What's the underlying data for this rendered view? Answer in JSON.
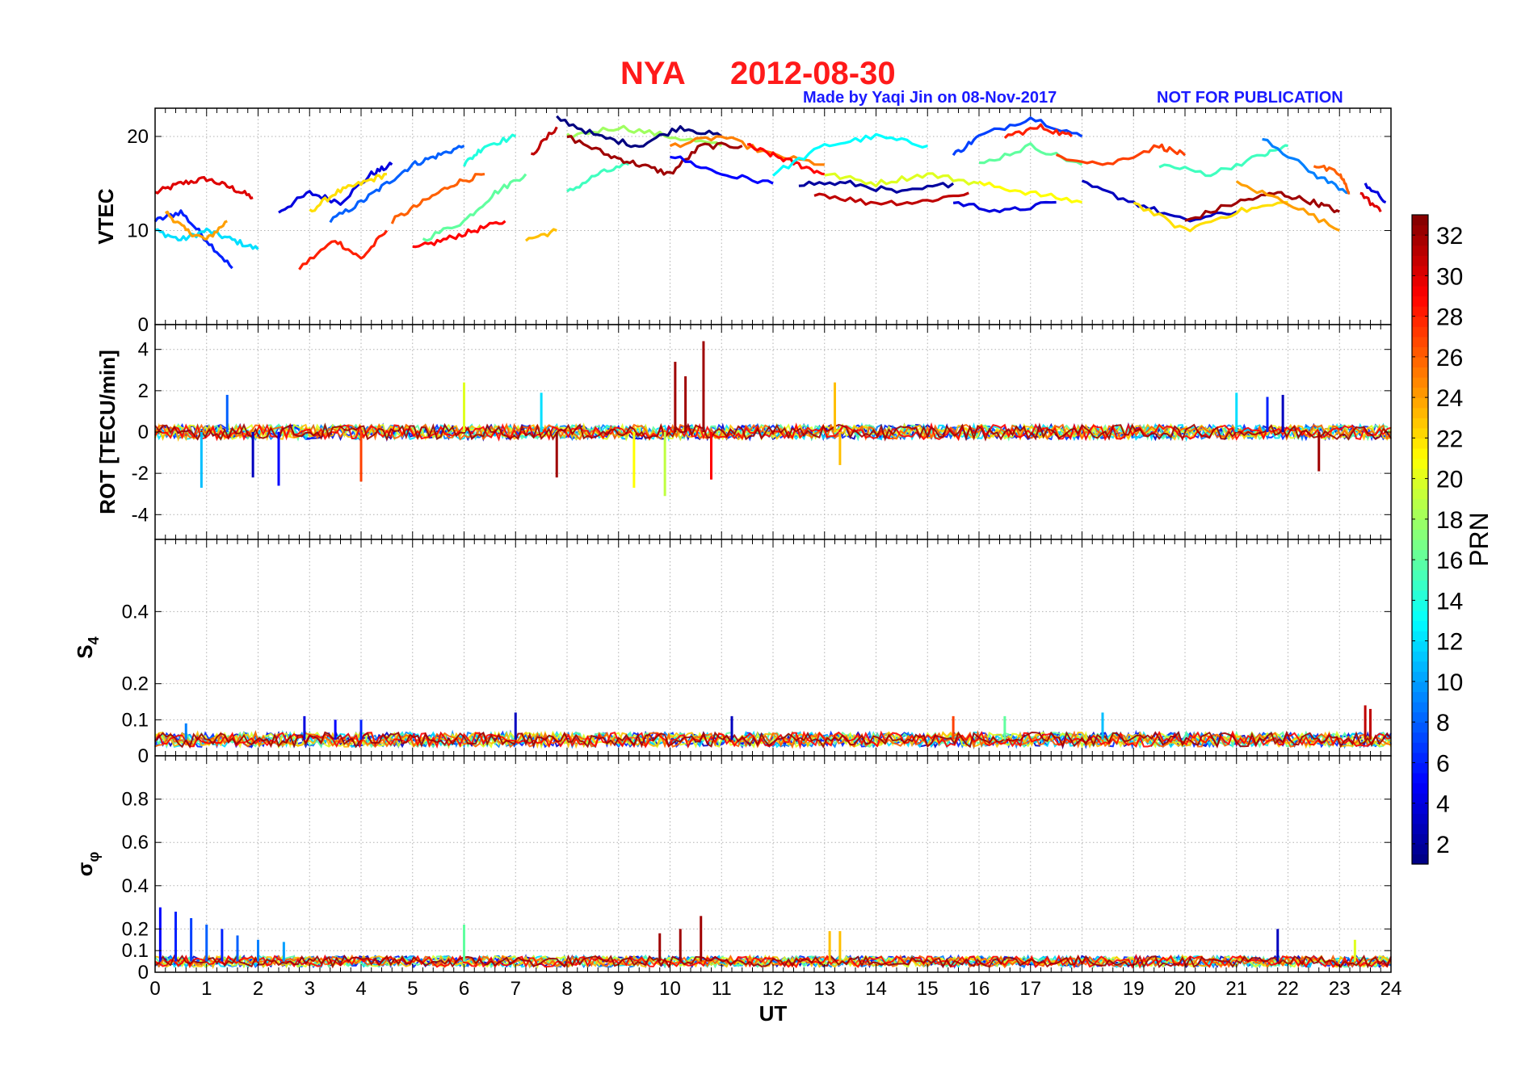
{
  "header": {
    "station": "NYA",
    "date": "2012-08-30",
    "credit": "Made by Yaqi Jin on 08-Nov-2017",
    "notice": "NOT FOR PUBLICATION",
    "title_color": "#ff1a1a",
    "credit_color": "#1a1aff"
  },
  "colorbar": {
    "label": "PRN",
    "range": [
      1,
      33
    ],
    "ticks": [
      "2",
      "4",
      "6",
      "8",
      "10",
      "12",
      "14",
      "16",
      "18",
      "20",
      "22",
      "24",
      "26",
      "28",
      "30",
      "32"
    ],
    "tick_values": [
      2,
      4,
      6,
      8,
      10,
      12,
      14,
      16,
      18,
      20,
      22,
      24,
      26,
      28,
      30,
      32
    ],
    "colormap": "jet"
  },
  "chart_data": [
    {
      "type": "line",
      "panel": "vtec",
      "ylabel": "VTEC",
      "ylim": [
        0,
        23
      ],
      "yticks": [
        "0",
        "10",
        "20"
      ],
      "ytick_values": [
        0,
        10,
        20
      ],
      "xlim": [
        0,
        24
      ],
      "grid": true,
      "series": [
        {
          "prn": 30,
          "x": [
            0,
            0.5,
            1,
            1.5,
            1.9
          ],
          "values": [
            14,
            15,
            15.5,
            14.5,
            13.5
          ]
        },
        {
          "prn": 6,
          "x": [
            0,
            0.5,
            1,
            1.5
          ],
          "values": [
            11,
            12,
            9,
            6
          ]
        },
        {
          "prn": 12,
          "x": [
            0,
            0.5,
            1,
            1.5,
            2
          ],
          "values": [
            10,
            9,
            10,
            9,
            8
          ]
        },
        {
          "prn": 24,
          "x": [
            0.2,
            0.6,
            1,
            1.4
          ],
          "values": [
            12,
            10,
            9,
            11
          ]
        },
        {
          "prn": 4,
          "x": [
            2.4,
            3,
            3.6,
            4.2,
            4.6
          ],
          "values": [
            12,
            14,
            13,
            16,
            17
          ]
        },
        {
          "prn": 28,
          "x": [
            2.8,
            3.5,
            4,
            4.5
          ],
          "values": [
            6,
            9,
            7,
            10
          ]
        },
        {
          "prn": 22,
          "x": [
            3,
            3.5,
            4,
            4.5
          ],
          "values": [
            12,
            14,
            15,
            16
          ]
        },
        {
          "prn": 8,
          "x": [
            3.4,
            4,
            4.5,
            5,
            5.5,
            6
          ],
          "values": [
            11,
            13,
            15,
            17,
            18,
            19
          ]
        },
        {
          "prn": 26,
          "x": [
            4.6,
            5.2,
            5.8,
            6.4
          ],
          "values": [
            11,
            13,
            15,
            16
          ]
        },
        {
          "prn": 29,
          "x": [
            5,
            5.6,
            6.2,
            6.8
          ],
          "values": [
            8,
            9,
            10,
            11
          ]
        },
        {
          "prn": 16,
          "x": [
            5.2,
            6,
            6.6,
            7.2
          ],
          "values": [
            9,
            11,
            14,
            16
          ]
        },
        {
          "prn": 14,
          "x": [
            6,
            6.4,
            7
          ],
          "values": [
            17,
            19,
            20
          ]
        },
        {
          "prn": 31,
          "x": [
            7.3,
            7.8
          ],
          "values": [
            18,
            21
          ]
        },
        {
          "prn": 23,
          "x": [
            7.2,
            7.8
          ],
          "values": [
            9,
            10
          ]
        },
        {
          "prn": 15,
          "x": [
            8,
            8.6,
            9.2
          ],
          "values": [
            14,
            16,
            17
          ]
        },
        {
          "prn": 18,
          "x": [
            8,
            9,
            10,
            11
          ],
          "values": [
            20,
            21,
            20,
            19
          ]
        },
        {
          "prn": 1,
          "x": [
            7.8,
            8.6,
            9.4,
            10.2,
            11
          ],
          "values": [
            22,
            20,
            19,
            21,
            20
          ]
        },
        {
          "prn": 32,
          "x": [
            8,
            8.8,
            9.4,
            10,
            10.6,
            11.4
          ],
          "values": [
            20,
            18,
            17,
            16,
            19,
            19
          ]
        },
        {
          "prn": 5,
          "x": [
            10,
            11,
            12
          ],
          "values": [
            18,
            16,
            15
          ]
        },
        {
          "prn": 25,
          "x": [
            10,
            11,
            12,
            13
          ],
          "values": [
            19,
            20,
            18,
            17
          ]
        },
        {
          "prn": 29,
          "x": [
            11.5,
            12,
            12.5,
            13
          ],
          "values": [
            19,
            18,
            17,
            16
          ]
        },
        {
          "prn": 13,
          "x": [
            12,
            13,
            14,
            15
          ],
          "values": [
            16,
            19,
            20,
            19
          ]
        },
        {
          "prn": 2,
          "x": [
            12.5,
            13.5,
            14.5,
            15.5
          ],
          "values": [
            15,
            15,
            14,
            15
          ]
        },
        {
          "prn": 31,
          "x": [
            12.8,
            13.8,
            14.8,
            15.8
          ],
          "values": [
            14,
            13,
            13,
            14
          ]
        },
        {
          "prn": 20,
          "x": [
            13,
            14,
            15,
            16
          ],
          "values": [
            16,
            15,
            16,
            15
          ]
        },
        {
          "prn": 7,
          "x": [
            15.5,
            16,
            17,
            18
          ],
          "values": [
            18,
            20,
            22,
            20
          ]
        },
        {
          "prn": 16,
          "x": [
            16,
            17,
            18
          ],
          "values": [
            17,
            19,
            17
          ]
        },
        {
          "prn": 21,
          "x": [
            16,
            17,
            18
          ],
          "values": [
            15,
            14,
            13
          ]
        },
        {
          "prn": 4,
          "x": [
            15.5,
            16.5,
            17.5
          ],
          "values": [
            13,
            12,
            13
          ]
        },
        {
          "prn": 28,
          "x": [
            16.5,
            17.2,
            17.8
          ],
          "values": [
            20,
            21,
            20
          ]
        },
        {
          "prn": 27,
          "x": [
            17.5,
            18.5,
            19.5,
            20
          ],
          "values": [
            18,
            17,
            19,
            18
          ]
        },
        {
          "prn": 3,
          "x": [
            18,
            19,
            20,
            21
          ],
          "values": [
            15,
            13,
            11,
            12
          ]
        },
        {
          "prn": 22,
          "x": [
            19,
            20,
            21,
            22
          ],
          "values": [
            13,
            10,
            12,
            13
          ]
        },
        {
          "prn": 15,
          "x": [
            19.5,
            20.5,
            21.5,
            22
          ],
          "values": [
            17,
            16,
            18,
            19
          ]
        },
        {
          "prn": 32,
          "x": [
            20,
            21,
            21.8,
            22.5,
            23
          ],
          "values": [
            11,
            13,
            14,
            13,
            12
          ]
        },
        {
          "prn": 24,
          "x": [
            21,
            22,
            23
          ],
          "values": [
            15,
            13,
            10
          ]
        },
        {
          "prn": 9,
          "x": [
            21.5,
            22.5,
            23.2
          ],
          "values": [
            20,
            16,
            14
          ]
        },
        {
          "prn": 26,
          "x": [
            22.5,
            23,
            23.2
          ],
          "values": [
            17,
            16,
            14
          ]
        },
        {
          "prn": 30,
          "x": [
            23.4,
            23.8
          ],
          "values": [
            14,
            12
          ]
        },
        {
          "prn": 4,
          "x": [
            23.5,
            23.9
          ],
          "values": [
            15,
            13
          ]
        }
      ]
    },
    {
      "type": "line",
      "panel": "rot",
      "ylabel": "ROT [TECU/min]",
      "ylim": [
        -5.2,
        5.2
      ],
      "yticks": [
        "-4",
        "-2",
        "0",
        "2",
        "4"
      ],
      "ytick_values": [
        -4,
        -2,
        0,
        2,
        4
      ],
      "xlim": [
        0,
        24
      ],
      "grid": true,
      "baseline": 0,
      "noise_amplitude": 0.35,
      "spikes": [
        {
          "x": 0.9,
          "value": -2.7,
          "prn": 11
        },
        {
          "x": 1.4,
          "value": 1.8,
          "prn": 8
        },
        {
          "x": 1.9,
          "value": -2.2,
          "prn": 3
        },
        {
          "x": 2.4,
          "value": -2.6,
          "prn": 5
        },
        {
          "x": 4,
          "value": -2.4,
          "prn": 27
        },
        {
          "x": 6,
          "value": 2.4,
          "prn": 20
        },
        {
          "x": 7.5,
          "value": 1.9,
          "prn": 12
        },
        {
          "x": 7.8,
          "value": -2.2,
          "prn": 32
        },
        {
          "x": 9.3,
          "value": -2.7,
          "prn": 21
        },
        {
          "x": 9.9,
          "value": -3.1,
          "prn": 19
        },
        {
          "x": 10.1,
          "value": 3.4,
          "prn": 32
        },
        {
          "x": 10.3,
          "value": 2.7,
          "prn": 32
        },
        {
          "x": 10.65,
          "value": 4.4,
          "prn": 32
        },
        {
          "x": 10.8,
          "value": -2.3,
          "prn": 29
        },
        {
          "x": 13.2,
          "value": 2.4,
          "prn": 23
        },
        {
          "x": 13.3,
          "value": -1.6,
          "prn": 23
        },
        {
          "x": 21,
          "value": 1.9,
          "prn": 12
        },
        {
          "x": 21.6,
          "value": 1.7,
          "prn": 6
        },
        {
          "x": 21.9,
          "value": 1.8,
          "prn": 3
        },
        {
          "x": 22.6,
          "value": -1.9,
          "prn": 32
        }
      ]
    },
    {
      "type": "line",
      "panel": "s4",
      "ylabel": "S",
      "ylabel_sub": "4",
      "ylim": [
        0,
        0.6
      ],
      "yticks": [
        "0",
        "0.1",
        "0.2",
        "0.4"
      ],
      "ytick_values": [
        0,
        0.1,
        0.2,
        0.4
      ],
      "xlim": [
        0,
        24
      ],
      "grid": true,
      "baseline": 0.045,
      "noise_amplitude": 0.02,
      "spikes": [
        {
          "x": 0.6,
          "value": 0.09,
          "prn": 9
        },
        {
          "x": 2.9,
          "value": 0.11,
          "prn": 4
        },
        {
          "x": 3.5,
          "value": 0.1,
          "prn": 5
        },
        {
          "x": 4,
          "value": 0.1,
          "prn": 6
        },
        {
          "x": 7,
          "value": 0.12,
          "prn": 3
        },
        {
          "x": 11.2,
          "value": 0.11,
          "prn": 3
        },
        {
          "x": 15.5,
          "value": 0.11,
          "prn": 27
        },
        {
          "x": 16.5,
          "value": 0.11,
          "prn": 16
        },
        {
          "x": 18.4,
          "value": 0.12,
          "prn": 11
        },
        {
          "x": 23.5,
          "value": 0.14,
          "prn": 31
        },
        {
          "x": 23.6,
          "value": 0.13,
          "prn": 31
        }
      ]
    },
    {
      "type": "line",
      "panel": "sigma_phi",
      "ylabel": "σ",
      "ylabel_sub": "φ",
      "ylim": [
        0,
        1
      ],
      "yticks": [
        "0",
        "0.1",
        "0.2",
        "0.4",
        "0.6",
        "0.8"
      ],
      "ytick_values": [
        0,
        0.1,
        0.2,
        0.4,
        0.6,
        0.8
      ],
      "xlim": [
        0,
        24
      ],
      "grid": true,
      "baseline": 0.05,
      "noise_amplitude": 0.025,
      "spikes": [
        {
          "x": 0.1,
          "value": 0.3,
          "prn": 5
        },
        {
          "x": 0.4,
          "value": 0.28,
          "prn": 6
        },
        {
          "x": 0.7,
          "value": 0.25,
          "prn": 7
        },
        {
          "x": 1,
          "value": 0.22,
          "prn": 8
        },
        {
          "x": 1.3,
          "value": 0.2,
          "prn": 6
        },
        {
          "x": 1.6,
          "value": 0.17,
          "prn": 8
        },
        {
          "x": 2,
          "value": 0.15,
          "prn": 9
        },
        {
          "x": 2.5,
          "value": 0.14,
          "prn": 10
        },
        {
          "x": 6,
          "value": 0.22,
          "prn": 16
        },
        {
          "x": 9.8,
          "value": 0.18,
          "prn": 32
        },
        {
          "x": 10.2,
          "value": 0.2,
          "prn": 32
        },
        {
          "x": 10.6,
          "value": 0.26,
          "prn": 32
        },
        {
          "x": 13.1,
          "value": 0.19,
          "prn": 23
        },
        {
          "x": 13.3,
          "value": 0.19,
          "prn": 23
        },
        {
          "x": 21.8,
          "value": 0.2,
          "prn": 3
        },
        {
          "x": 23.3,
          "value": 0.15,
          "prn": 20
        }
      ]
    }
  ],
  "xaxis": {
    "label": "UT",
    "ticks": [
      "0",
      "1",
      "2",
      "3",
      "4",
      "5",
      "6",
      "7",
      "8",
      "9",
      "10",
      "11",
      "12",
      "13",
      "14",
      "15",
      "16",
      "17",
      "18",
      "19",
      "20",
      "21",
      "22",
      "23",
      "24"
    ],
    "tick_values": [
      0,
      1,
      2,
      3,
      4,
      5,
      6,
      7,
      8,
      9,
      10,
      11,
      12,
      13,
      14,
      15,
      16,
      17,
      18,
      19,
      20,
      21,
      22,
      23,
      24
    ]
  }
}
